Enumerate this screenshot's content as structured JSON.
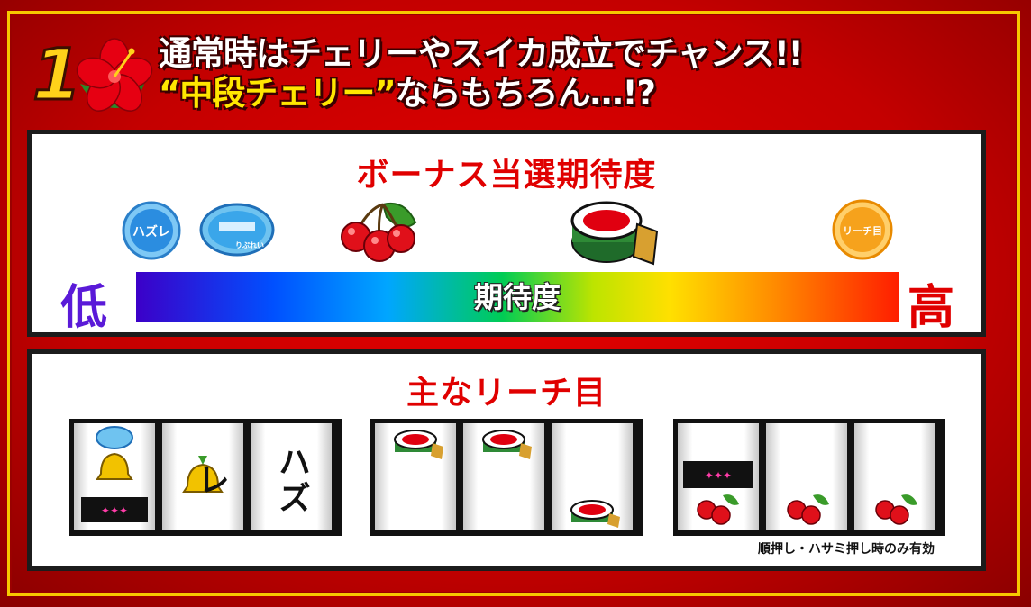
{
  "header": {
    "number": "1",
    "line1": "通常時はチェリーやスイカ成立でチャンス!!",
    "line2_quote_open": "“",
    "line2_highlight": "中段チェリー",
    "line2_quote_close": "”",
    "line2_rest": "ならもちろん…!?"
  },
  "bonus_panel": {
    "title": "ボーナス当選期待度",
    "icons": [
      {
        "name": "hazure-badge",
        "label": "ハズレ"
      },
      {
        "name": "replay-icon",
        "label": "りぷれい"
      },
      {
        "name": "cherry-icon"
      },
      {
        "name": "taiko-drum-icon"
      },
      {
        "name": "reach-badge",
        "label": "リーチ目"
      }
    ],
    "low_label": "低",
    "high_label": "高",
    "bar_label": "期待度",
    "colors": {
      "low": "#5a1ad8",
      "high": "#e00000"
    }
  },
  "reach_panel": {
    "title": "主なリーチ目",
    "set1": [
      "replay+bell+logo",
      "bell",
      "ハズレ"
    ],
    "set1_hazure": "ハズレ",
    "set2": [
      "drum-top",
      "drum-top",
      "drum-bottom"
    ],
    "set3": [
      "logo+cherry",
      "cherry",
      "cherry"
    ],
    "note": "順押し・ハサミ押し時のみ有効"
  }
}
